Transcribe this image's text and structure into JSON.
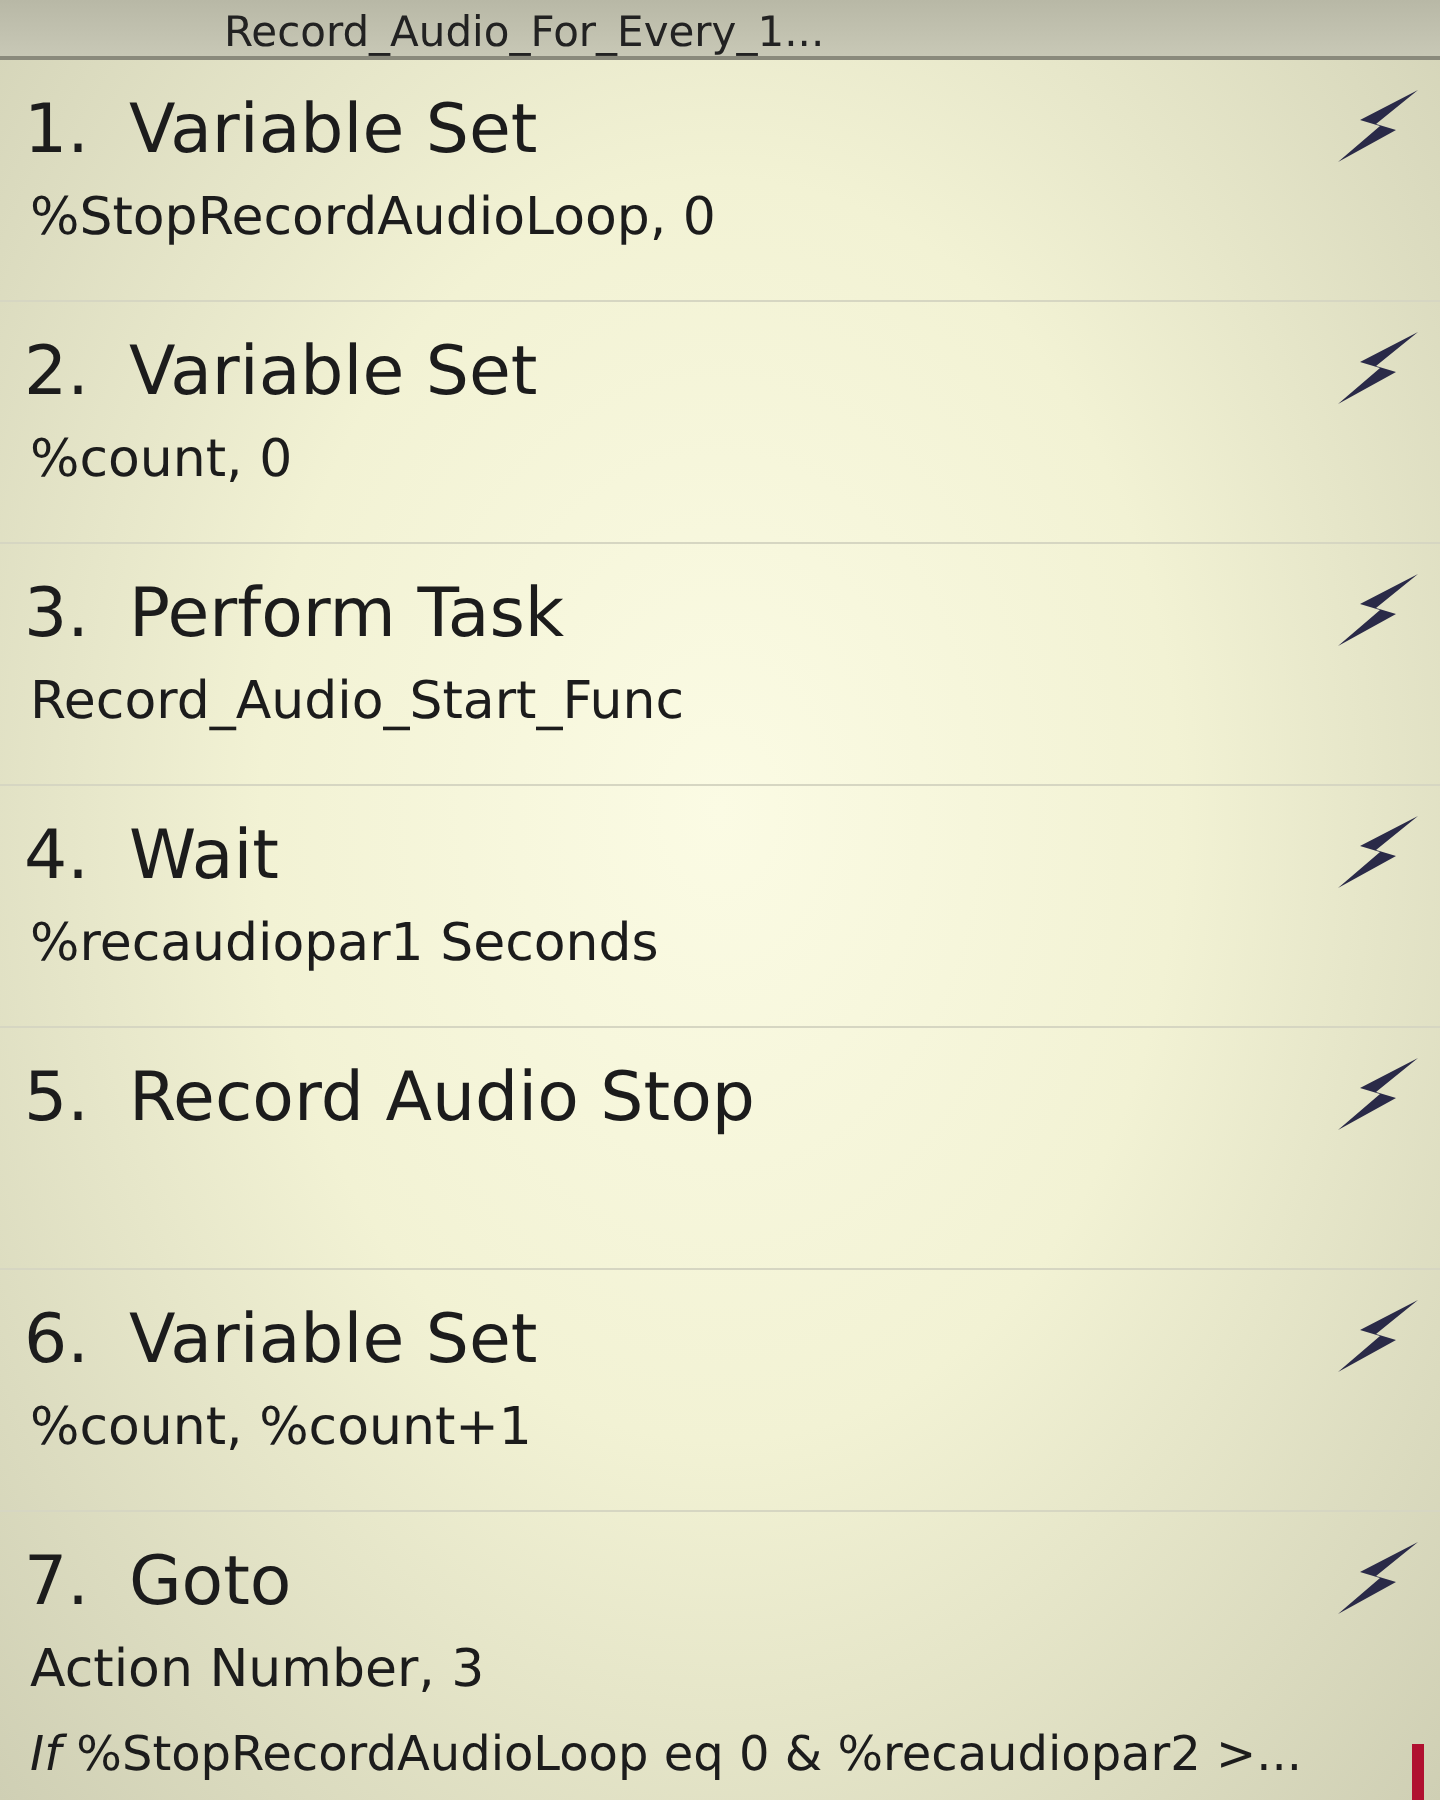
{
  "header": {
    "title": "Record_Audio_For_Every_1..."
  },
  "actions": [
    {
      "number": "1.",
      "name": "Variable Set",
      "detail": "%StopRecordAudioLoop,  0"
    },
    {
      "number": "2.",
      "name": "Variable Set",
      "detail": "%count,  0"
    },
    {
      "number": "3.",
      "name": "Perform Task",
      "detail": "Record_Audio_Start_Func"
    },
    {
      "number": "4.",
      "name": "Wait",
      "detail": "%recaudiopar1 Seconds"
    },
    {
      "number": "5.",
      "name": "Record Audio Stop"
    },
    {
      "number": "6.",
      "name": "Variable Set",
      "detail": "%count,  %count+1"
    },
    {
      "number": "7.",
      "name": "Goto",
      "detail": "Action Number,  3",
      "condition": "*If*  %StopRecordAudioLoop eq 0 & %recaudiopar2 >..."
    }
  ]
}
